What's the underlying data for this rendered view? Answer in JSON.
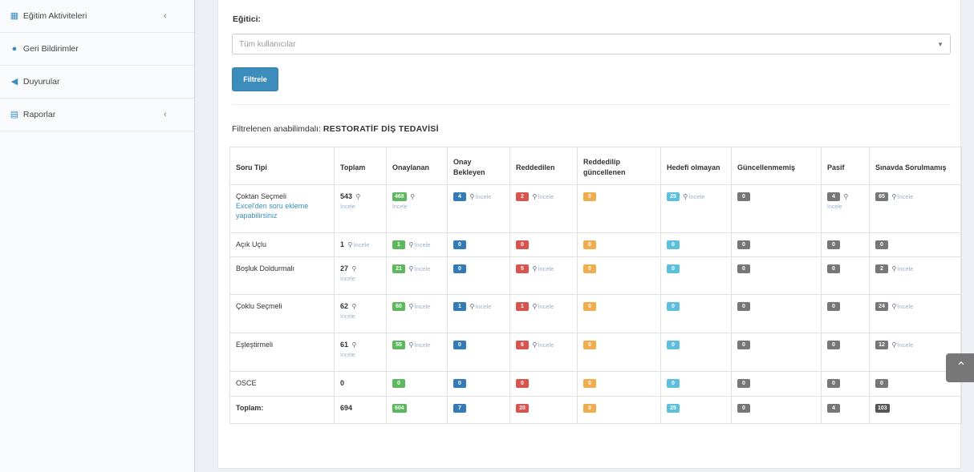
{
  "sidebar": {
    "items": [
      {
        "label": "Eğitim Aktiviteleri",
        "icon": "grid-icon",
        "has_chevron": true
      },
      {
        "label": "Geri Bildirimler",
        "icon": "comment-icon",
        "has_chevron": false
      },
      {
        "label": "Duyurular",
        "icon": "bullhorn-icon",
        "has_chevron": false
      },
      {
        "label": "Raporlar",
        "icon": "table-icon",
        "has_chevron": true
      }
    ],
    "chevron": "‹"
  },
  "filter": {
    "label": "Eğitici:",
    "select_placeholder": "Tüm kullanıcılar",
    "button_label": "Filtrele"
  },
  "summary": {
    "prefix": "Filtrelenen anabilimdalı:",
    "department": "RESTORATİF DİŞ TEDAVİSİ"
  },
  "table": {
    "headers": [
      "Soru Tipi",
      "Toplam",
      "Onaylanan",
      "Onay Bekleyen",
      "Reddedilen",
      "Reddedilip güncellenen",
      "Hedefi olmayan",
      "Güncellenmemiş",
      "Pasif",
      "Sınavda Sorulmamış"
    ],
    "inspect_label": "İncele",
    "rows": [
      {
        "type": "Çoktan Seçmeli",
        "type_link": "Excel'den soru ekleme yapabilirsiniz",
        "total": "543",
        "approved": "468",
        "pending": "4",
        "rejected": "2",
        "rejected_updated": "0",
        "no_target": "25",
        "not_updated": "0",
        "passive": "4",
        "not_asked": "65"
      },
      {
        "type": "Açık Uçlu",
        "total": "1",
        "approved": "1",
        "pending": "0",
        "rejected": "0",
        "rejected_updated": "0",
        "no_target": "0",
        "not_updated": "0",
        "passive": "0",
        "not_asked": "0"
      },
      {
        "type": "Boşluk Doldurmalı",
        "total": "27",
        "approved": "21",
        "pending": "0",
        "rejected": "5",
        "rejected_updated": "0",
        "no_target": "0",
        "not_updated": "0",
        "passive": "0",
        "not_asked": "2"
      },
      {
        "type": "Çoklu Seçmeli",
        "total": "62",
        "approved": "60",
        "pending": "1",
        "rejected": "1",
        "rejected_updated": "0",
        "no_target": "0",
        "not_updated": "0",
        "passive": "0",
        "not_asked": "24"
      },
      {
        "type": "Eşleştirmeli",
        "total": "61",
        "approved": "55",
        "pending": "0",
        "rejected": "6",
        "rejected_updated": "0",
        "no_target": "0",
        "not_updated": "0",
        "passive": "0",
        "not_asked": "12"
      },
      {
        "type": "OSCE",
        "total": "0",
        "approved": "0",
        "pending": "0",
        "rejected": "0",
        "rejected_updated": "0",
        "no_target": "0",
        "not_updated": "0",
        "passive": "0",
        "not_asked": "0"
      }
    ],
    "totals": {
      "label": "Toplam:",
      "total": "694",
      "approved": "604",
      "pending": "7",
      "rejected": "20",
      "rejected_updated": "0",
      "no_target": "25",
      "not_updated": "0",
      "passive": "4",
      "not_asked": "103"
    }
  },
  "scroll_top_icon": "chevron-up-icon",
  "colors": {
    "primary": "#3c8dbc",
    "approved": "#5cb85c",
    "pending": "#337ab7",
    "rejected": "#d9534f",
    "rejected_updated": "#f0ad4e",
    "no_target": "#5bc0de",
    "neutral": "#777777"
  }
}
